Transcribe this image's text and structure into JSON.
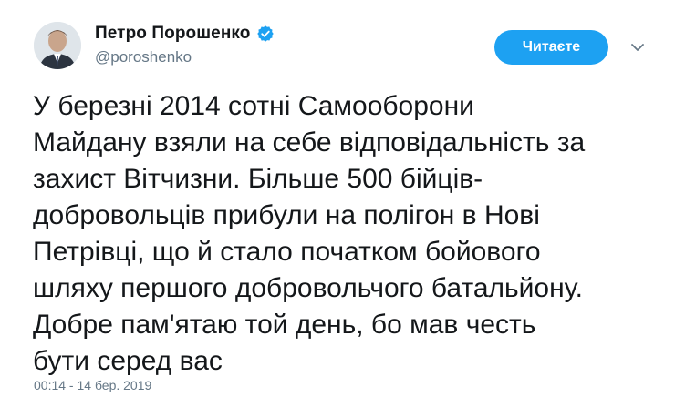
{
  "user": {
    "display_name": "Петро Порошенко",
    "handle": "@poroshenko",
    "verified_icon": "verified-badge-icon",
    "avatar_icon": "profile-photo"
  },
  "follow_button": {
    "label": "Читаєте"
  },
  "menu": {
    "icon": "chevron-down-icon"
  },
  "tweet": {
    "lines": [
      "У березні 2014 сотні Самооборони",
      "Майдану взяли на себе відповідальність за",
      "захист Вітчизни. Більше 500 бійців-",
      "добровольців прибули на полігон в Нові",
      "Петрівці, що й стало початком бойового",
      "шляху першого добровольчого батальйону.",
      "Добре пам'ятаю той день, бо мав честь",
      "бути серед вас"
    ],
    "timestamp": "00:14 - 14 бер. 2019"
  },
  "colors": {
    "accent": "#1da1f2",
    "text": "#14171a",
    "secondary": "#657786"
  }
}
